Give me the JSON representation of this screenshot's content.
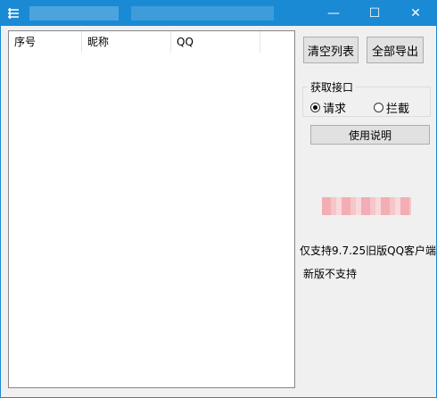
{
  "window": {
    "title_bar_color": "#1a8ad4",
    "minimize_glyph": "—",
    "maximize_glyph": "☐",
    "close_glyph": "✕"
  },
  "list": {
    "columns": [
      "序号",
      "昵称",
      "QQ"
    ]
  },
  "buttons": {
    "clear_list": "清空列表",
    "export_all": "全部导出",
    "help": "使用说明"
  },
  "interface_group": {
    "legend": "获取接口",
    "options": [
      "请求",
      "拦截"
    ],
    "selected": "请求"
  },
  "notes": {
    "line1": "仅支持9.7.25旧版QQ客户端",
    "line2": "新版不支持"
  }
}
